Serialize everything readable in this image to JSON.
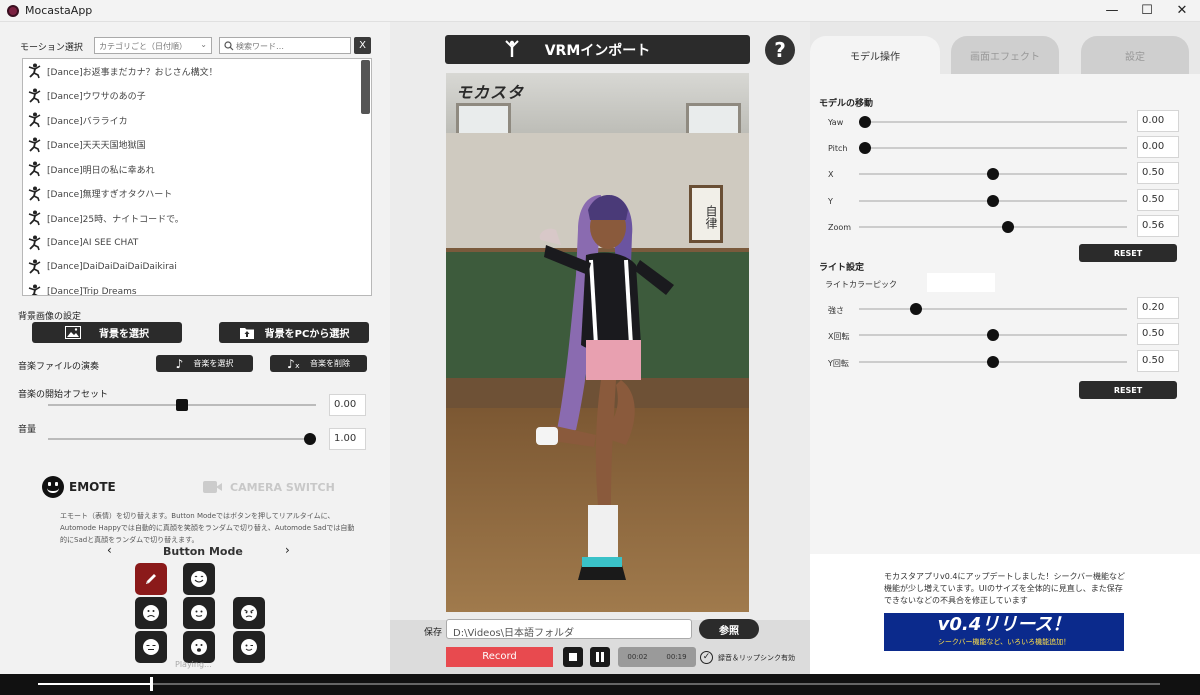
{
  "window": {
    "title": "MocastaApp",
    "min": "—",
    "max": "☐",
    "close": "✕"
  },
  "left": {
    "motion_label": "モーション選択",
    "category_select": "カテゴリごと（日付順）",
    "search_placeholder": "検索ワード…",
    "clear_label": "X",
    "motions": [
      "[Dance]お返事まだカナ？おじさん構文！",
      "[Dance]ウワサのあの子",
      "[Dance]バラライカ",
      "[Dance]天天天国地獄国",
      "[Dance]明日の私に幸あれ",
      "[Dance]無理すぎオタクハート",
      "[Dance]25時、ナイトコードで。",
      "[Dance]AI SEE CHAT",
      "[Dance]DaiDaiDaiDaiDaikirai",
      "[Dance]Trip Dreams"
    ],
    "bg_label": "背景画像の設定",
    "bg_select": "背景を選択",
    "bg_pc_select": "背景をPCから選択",
    "music_label": "音楽ファイルの演奏",
    "music_select": "音楽を選択",
    "music_delete": "音楽を削除",
    "offset_label": "音楽の開始オフセット",
    "offset_value": "0.00",
    "offset_level": 0.5,
    "volume_label": "音量",
    "volume_value": "1.00",
    "volume_level": 1.0,
    "emote_label": "EMOTE",
    "camera_label": "CAMERA SWITCH",
    "description": "エモート（表情）を切り替えます。Button Modeではボタンを押してリアルタイムに、Automode Happyでは自動的に真顔を笑顔をランダムで切り替え、Automode Sadでは自動的にSadと真顔をランダムで切り替えます。",
    "mode_prev": "‹",
    "mode_label": "Button Mode",
    "mode_next": "›",
    "playing_label": "Playing..."
  },
  "center": {
    "vrm_import": "VRMインポート",
    "help": "?",
    "logo": "モカスタ",
    "board_sign": "自律",
    "save_label": "保存",
    "save_path": "D:\\Videos\\日本語フォルダ",
    "browse": "参照",
    "record": "Record",
    "time_current": "00:02",
    "time_total": "00:19",
    "lipsync_label": "録音＆リップシンク有効"
  },
  "right": {
    "tabs": [
      "モデル操作",
      "画面エフェクト",
      "設定"
    ],
    "move_label": "モデルの移動",
    "move_sliders": [
      {
        "name": "Yaw",
        "value": "0.00",
        "level": 0.0
      },
      {
        "name": "Pitch",
        "value": "0.00",
        "level": 0.0
      },
      {
        "name": "X",
        "value": "0.50",
        "level": 0.5
      },
      {
        "name": "Y",
        "value": "0.50",
        "level": 0.5
      },
      {
        "name": "Zoom",
        "value": "0.56",
        "level": 0.56
      }
    ],
    "reset1": "RESET",
    "light_label": "ライト設定",
    "light_color_label": "ライトカラーピック",
    "light_sliders": [
      {
        "name": "強さ",
        "value": "0.20",
        "level": 0.2
      },
      {
        "name": "X回転",
        "value": "0.50",
        "level": 0.5
      },
      {
        "name": "Y回転",
        "value": "0.50",
        "level": 0.5
      }
    ],
    "reset2": "RESET",
    "announce": "モカスタアプリv0.4にアップデートしました！シークバー機能など機能が少し増えています。UIのサイズを全体的に見直し、また保存できないなどの不具合を修正しています",
    "banner_title": "v0.4リリース！",
    "banner_sub": "シークバー機能など、いろいろ機能追加！"
  },
  "seek": {
    "level": 0.1
  },
  "colors": {
    "record": "#e84a4f",
    "banner": "#0b2a8c",
    "dark": "#2b2b2b"
  }
}
